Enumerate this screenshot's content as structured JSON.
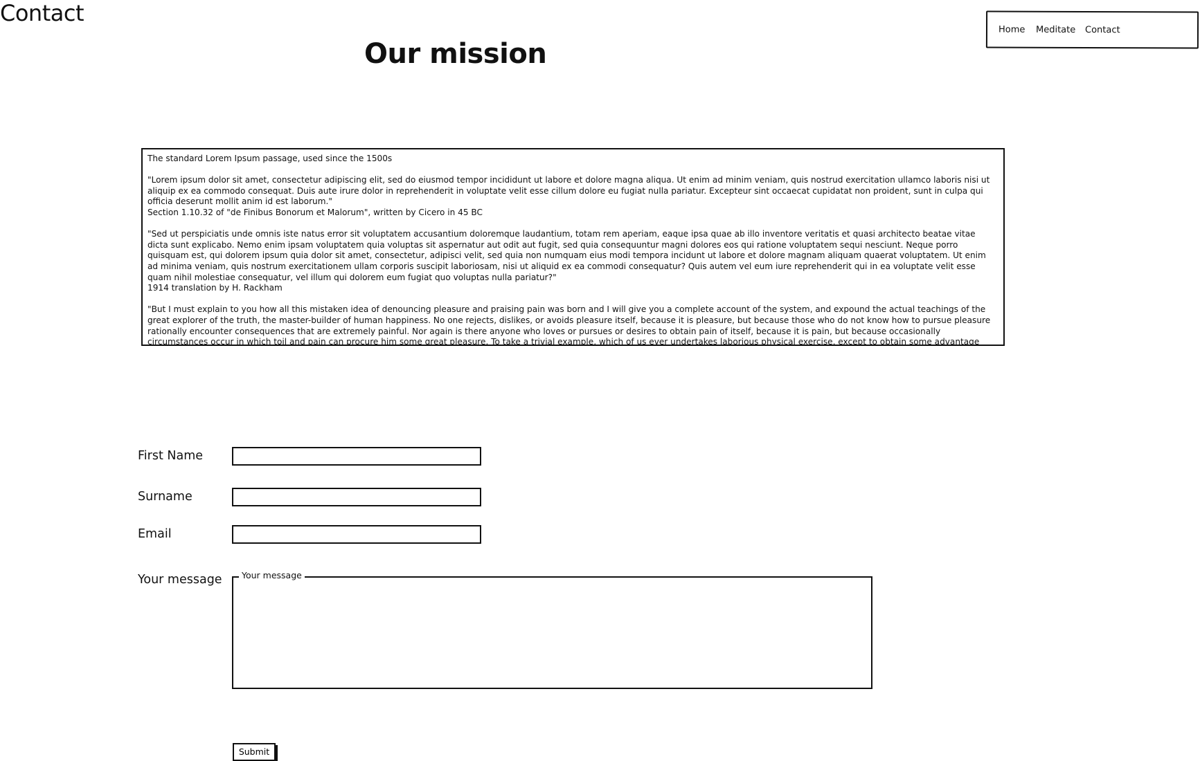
{
  "page": {
    "title": "Contact"
  },
  "nav": {
    "items": [
      {
        "label": "Home"
      },
      {
        "label": "Meditate"
      },
      {
        "label": "Contact"
      }
    ]
  },
  "mission": {
    "heading": "Our mission",
    "paragraphs": [
      "The standard Lorem Ipsum passage, used since the 1500s",
      "\"Lorem ipsum dolor sit amet, consectetur adipiscing elit, sed do eiusmod tempor incididunt ut labore et dolore magna aliqua. Ut enim ad minim veniam, quis nostrud exercitation ullamco laboris nisi ut aliquip ex ea commodo consequat. Duis aute irure dolor in reprehenderit in voluptate velit esse cillum dolore eu fugiat nulla pariatur. Excepteur sint occaecat cupidatat non proident, sunt in culpa qui officia deserunt mollit anim id est laborum.\"",
      "Section 1.10.32 of \"de Finibus Bonorum et Malorum\", written by Cicero in 45 BC",
      "\"Sed ut perspiciatis unde omnis iste natus error sit voluptatem accusantium doloremque laudantium, totam rem aperiam, eaque ipsa quae ab illo inventore veritatis et quasi architecto beatae vitae dicta sunt explicabo. Nemo enim ipsam voluptatem quia voluptas sit aspernatur aut odit aut fugit, sed quia consequuntur magni dolores eos qui ratione voluptatem sequi nesciunt. Neque porro quisquam est, qui dolorem ipsum quia dolor sit amet, consectetur, adipisci velit, sed quia non numquam eius modi tempora incidunt ut labore et dolore magnam aliquam quaerat voluptatem. Ut enim ad minima veniam, quis nostrum exercitationem ullam corporis suscipit laboriosam, nisi ut aliquid ex ea commodi consequatur? Quis autem vel eum iure reprehenderit qui in ea voluptate velit esse quam nihil molestiae consequatur, vel illum qui dolorem eum fugiat quo voluptas nulla pariatur?\"",
      "1914 translation by H. Rackham",
      "\"But I must explain to you how all this mistaken idea of denouncing pleasure and praising pain was born and I will give you a complete account of the system, and expound the actual teachings of the great explorer of the truth, the master-builder of human happiness. No one rejects, dislikes, or avoids pleasure itself, because it is pleasure, but because those who do not know how to pursue pleasure rationally encounter consequences that are extremely painful. Nor again is there anyone who loves or pursues or desires to obtain pain of itself, because it is pain, but because occasionally circumstances occur in which toil and pain can procure him some great pleasure. To take a trivial example, which of us ever undertakes laborious physical exercise, except to obtain some advantage from it? But who has any right to find fault"
    ]
  },
  "form": {
    "first_name": {
      "label": "First Name",
      "value": "",
      "placeholder": ""
    },
    "surname": {
      "label": "Surname",
      "value": "",
      "placeholder": ""
    },
    "email": {
      "label": "Email",
      "value": "",
      "placeholder": ""
    },
    "message": {
      "label": "Your message",
      "legend": "Your message",
      "value": ""
    },
    "submit_label": "Submit"
  }
}
